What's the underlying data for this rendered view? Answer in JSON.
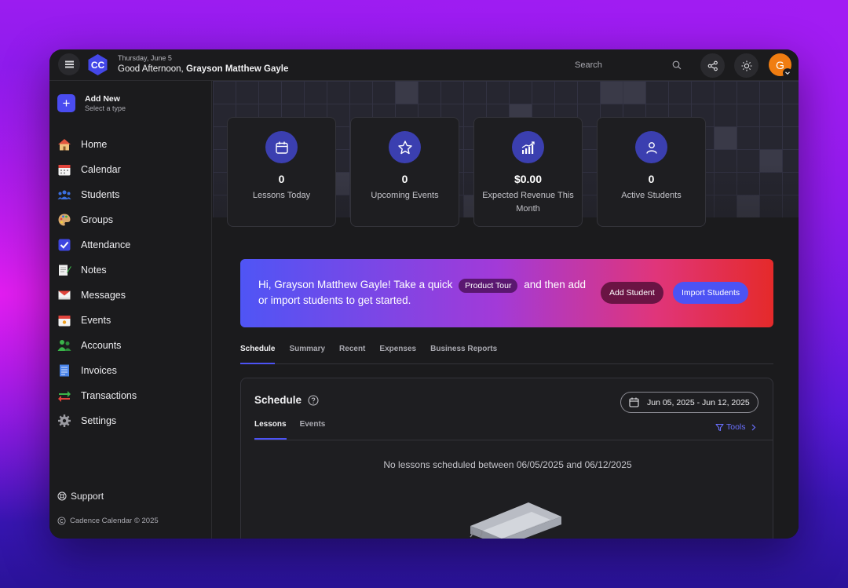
{
  "header": {
    "date": "Thursday, June 5",
    "greeting_prefix": "Good Afternoon,",
    "user_name": "Grayson Matthew Gayle",
    "logo_text": "CC",
    "search_placeholder": "Search",
    "avatar_initial": "G"
  },
  "sidebar": {
    "add_new_title": "Add New",
    "add_new_subtitle": "Select a type",
    "items": [
      {
        "label": "Home",
        "icon": "home-icon"
      },
      {
        "label": "Calendar",
        "icon": "calendar-icon"
      },
      {
        "label": "Students",
        "icon": "students-icon"
      },
      {
        "label": "Groups",
        "icon": "palette-icon"
      },
      {
        "label": "Attendance",
        "icon": "checkbox-icon"
      },
      {
        "label": "Notes",
        "icon": "notes-icon"
      },
      {
        "label": "Messages",
        "icon": "envelope-icon"
      },
      {
        "label": "Events",
        "icon": "events-icon"
      },
      {
        "label": "Accounts",
        "icon": "accounts-icon"
      },
      {
        "label": "Invoices",
        "icon": "invoice-icon"
      },
      {
        "label": "Transactions",
        "icon": "transactions-icon"
      },
      {
        "label": "Settings",
        "icon": "gear-icon"
      }
    ],
    "support_label": "Support",
    "copyright": "Cadence Calendar © 2025"
  },
  "stats": [
    {
      "value": "0",
      "label": "Lessons Today",
      "icon": "calendar-icon"
    },
    {
      "value": "0",
      "label": "Upcoming Events",
      "icon": "star-icon"
    },
    {
      "value": "$0.00",
      "label": "Expected Revenue This Month",
      "icon": "chart-icon"
    },
    {
      "value": "0",
      "label": "Active Students",
      "icon": "user-icon"
    }
  ],
  "banner": {
    "text_before": "Hi, Grayson Matthew Gayle! Take a quick",
    "pill": "Product Tour",
    "text_after": "and then add or import students to get started.",
    "add_student": "Add Student",
    "import_students": "Import Students"
  },
  "tabs": [
    "Schedule",
    "Summary",
    "Recent",
    "Expenses",
    "Business Reports"
  ],
  "schedule": {
    "title": "Schedule",
    "date_range": "Jun 05, 2025 - Jun 12, 2025",
    "sub_tabs": [
      "Lessons",
      "Events"
    ],
    "tools_label": "Tools",
    "empty_message": "No lessons scheduled between 06/05/2025 and 06/12/2025"
  },
  "colors": {
    "accent": "#4c53f4",
    "avatar": "#f07d11",
    "background": "#1b1b1d"
  }
}
